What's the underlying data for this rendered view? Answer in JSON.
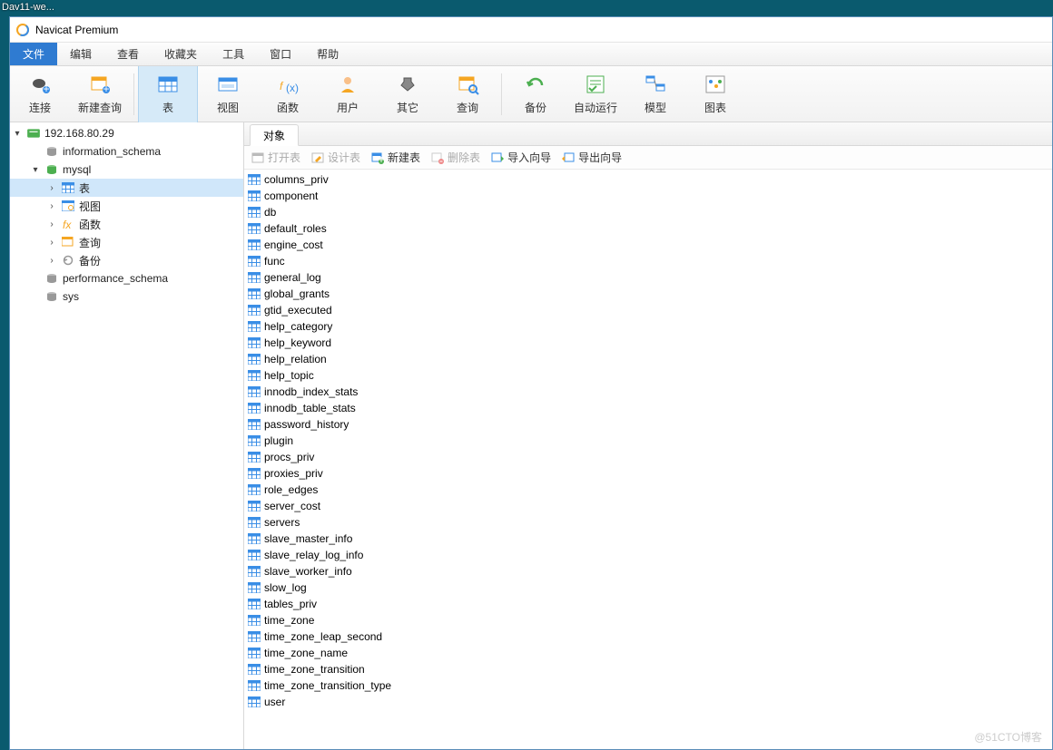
{
  "desktop_label": "Dav11-we...",
  "window_title": "Navicat Premium",
  "menu": {
    "items": [
      "文件",
      "编辑",
      "查看",
      "收藏夹",
      "工具",
      "窗口",
      "帮助"
    ],
    "active_index": 0
  },
  "toolbar": [
    {
      "label": "连接",
      "icon": "plug"
    },
    {
      "label": "新建查询",
      "icon": "new-query"
    },
    {
      "label": "表",
      "icon": "table",
      "selected": true
    },
    {
      "label": "视图",
      "icon": "view"
    },
    {
      "label": "函数",
      "icon": "fx"
    },
    {
      "label": "用户",
      "icon": "user"
    },
    {
      "label": "其它",
      "icon": "other"
    },
    {
      "label": "查询",
      "icon": "query"
    },
    {
      "label": "备份",
      "icon": "backup"
    },
    {
      "label": "自动运行",
      "icon": "auto"
    },
    {
      "label": "模型",
      "icon": "model"
    },
    {
      "label": "图表",
      "icon": "chart"
    }
  ],
  "sidebar": {
    "connection": "192.168.80.29",
    "nodes": [
      {
        "label": "information_schema",
        "icon": "db",
        "indent": 1,
        "arrow": ""
      },
      {
        "label": "mysql",
        "icon": "db-active",
        "indent": 1,
        "arrow": "▾"
      },
      {
        "label": "表",
        "icon": "table",
        "indent": 2,
        "arrow": "›",
        "selected": true
      },
      {
        "label": "视图",
        "icon": "view",
        "indent": 2,
        "arrow": "›"
      },
      {
        "label": "函数",
        "icon": "fx",
        "indent": 2,
        "arrow": "›"
      },
      {
        "label": "查询",
        "icon": "query",
        "indent": 2,
        "arrow": "›"
      },
      {
        "label": "备份",
        "icon": "backup",
        "indent": 2,
        "arrow": "›"
      },
      {
        "label": "performance_schema",
        "icon": "db",
        "indent": 1,
        "arrow": ""
      },
      {
        "label": "sys",
        "icon": "db",
        "indent": 1,
        "arrow": ""
      }
    ]
  },
  "tab_label": "对象",
  "actions": [
    {
      "label": "打开表",
      "icon": "open",
      "disabled": true
    },
    {
      "label": "设计表",
      "icon": "design",
      "disabled": true
    },
    {
      "label": "新建表",
      "icon": "newtable",
      "disabled": false
    },
    {
      "label": "删除表",
      "icon": "delete",
      "disabled": true
    },
    {
      "label": "导入向导",
      "icon": "import",
      "disabled": false
    },
    {
      "label": "导出向导",
      "icon": "export",
      "disabled": false
    }
  ],
  "tables": [
    "columns_priv",
    "component",
    "db",
    "default_roles",
    "engine_cost",
    "func",
    "general_log",
    "global_grants",
    "gtid_executed",
    "help_category",
    "help_keyword",
    "help_relation",
    "help_topic",
    "innodb_index_stats",
    "innodb_table_stats",
    "password_history",
    "plugin",
    "procs_priv",
    "proxies_priv",
    "role_edges",
    "server_cost",
    "servers",
    "slave_master_info",
    "slave_relay_log_info",
    "slave_worker_info",
    "slow_log",
    "tables_priv",
    "time_zone",
    "time_zone_leap_second",
    "time_zone_name",
    "time_zone_transition",
    "time_zone_transition_type",
    "user"
  ],
  "watermark": "@51CTO博客",
  "colors": {
    "accent": "#3a8ee6",
    "orange": "#f5a623",
    "green": "#4caf50",
    "gray": "#999"
  }
}
